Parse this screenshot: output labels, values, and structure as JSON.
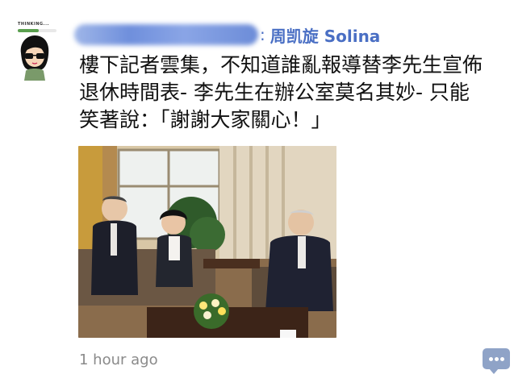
{
  "post": {
    "author_name": "周凯旋 Solina",
    "author_separator": ":",
    "text": "樓下記者雲集，不知道誰亂報導替李先生宣佈退休時間表- 李先生在辦公室莫名其妙- 只能笑著說：「謝謝大家關心！」",
    "timestamp": "1 hour ago"
  },
  "avatar": {
    "status_text": "THINKING...",
    "status_progress": 0.55
  },
  "actions": {
    "comment_icon": "comment-bubble-icon"
  }
}
